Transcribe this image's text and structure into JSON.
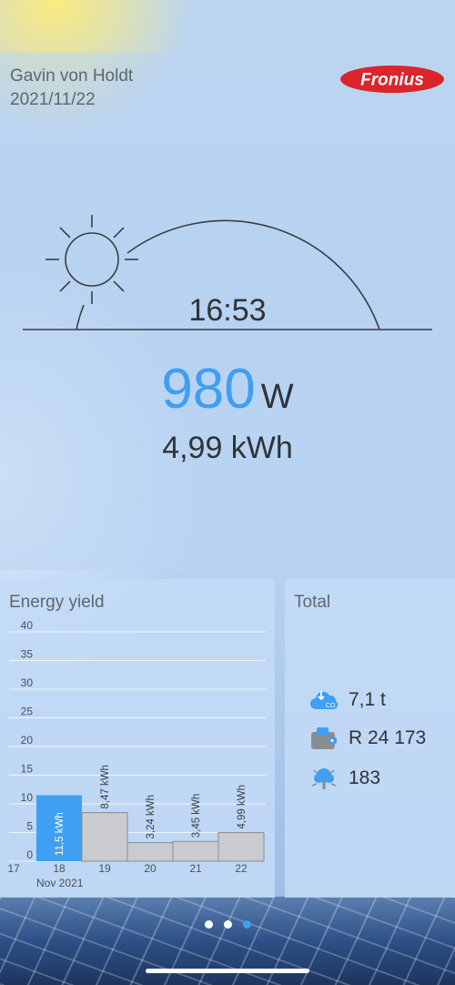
{
  "header": {
    "owner": "Gavin von Holdt",
    "date": "2021/11/22",
    "logo_text": "Fronius"
  },
  "live": {
    "time": "16:53",
    "power_value": "980",
    "power_unit": "W",
    "energy_today": "4,99 kWh",
    "day_progress": 0.8
  },
  "energy_yield": {
    "title": "Energy yield"
  },
  "total": {
    "title": "Total",
    "co2": "7,1 t",
    "money": "R 24 173",
    "trees": "183"
  },
  "pager": {
    "count": 3,
    "active": 2
  },
  "colors": {
    "accent": "#3f9ff0",
    "bar_selected": "#3f9ff0",
    "bar": "#c9cbce",
    "logo_red": "#d9252b"
  },
  "chart_data": {
    "type": "bar",
    "title": "Energy yield",
    "xlabel": "Nov 2021",
    "ylabel": "",
    "ylim": [
      0,
      40
    ],
    "yticks": [
      0,
      5,
      10,
      15,
      20,
      25,
      30,
      35,
      40
    ],
    "categories": [
      "17",
      "18",
      "19",
      "20",
      "21",
      "22"
    ],
    "values": [
      null,
      11.5,
      8.47,
      3.24,
      3.45,
      4.99
    ],
    "data_labels": [
      "",
      "11,5 kWh",
      "8,47 kWh",
      "3,24 kWh",
      "3,45 kWh",
      "4,99 kWh"
    ],
    "selected": "18",
    "grid": true
  }
}
